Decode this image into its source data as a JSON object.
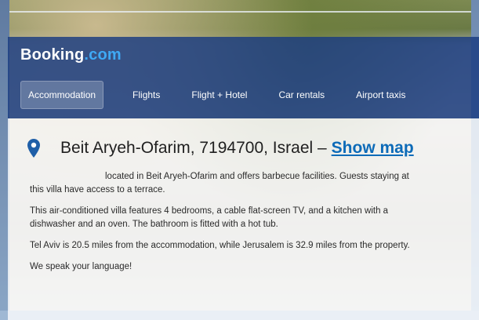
{
  "brand": {
    "name": "Booking",
    "tld": ".com"
  },
  "nav": [
    {
      "label": "Accommodation",
      "active": true
    },
    {
      "label": "Flights",
      "active": false
    },
    {
      "label": "Flight + Hotel",
      "active": false
    },
    {
      "label": "Car rentals",
      "active": false
    },
    {
      "label": "Airport taxis",
      "active": false
    }
  ],
  "property": {
    "address": "Beit Aryeh-Ofarim, 7194700, Israel –",
    "show_map": "Show map"
  },
  "description": {
    "p1": "located in Beit Aryeh-Ofarim and offers barbecue facilities. Guests staying at this villa have access to a terrace.",
    "p2": "This air-conditioned villa features 4 bedrooms, a cable flat-screen TV, and a kitchen with a dishwasher and an oven. The bathroom is fitted with a hot tub.",
    "p3": "Tel Aviv is 20.5 miles from the accommodation, while Jerusalem is 32.9 miles from the property.",
    "p4": "We speak your language!"
  },
  "colors": {
    "header_bg": "#183a80",
    "brand_tld": "#3fa9f5",
    "link": "#0d6bb8",
    "pin": "#1f5fa8"
  },
  "icons": {
    "location": "map-pin-icon"
  }
}
